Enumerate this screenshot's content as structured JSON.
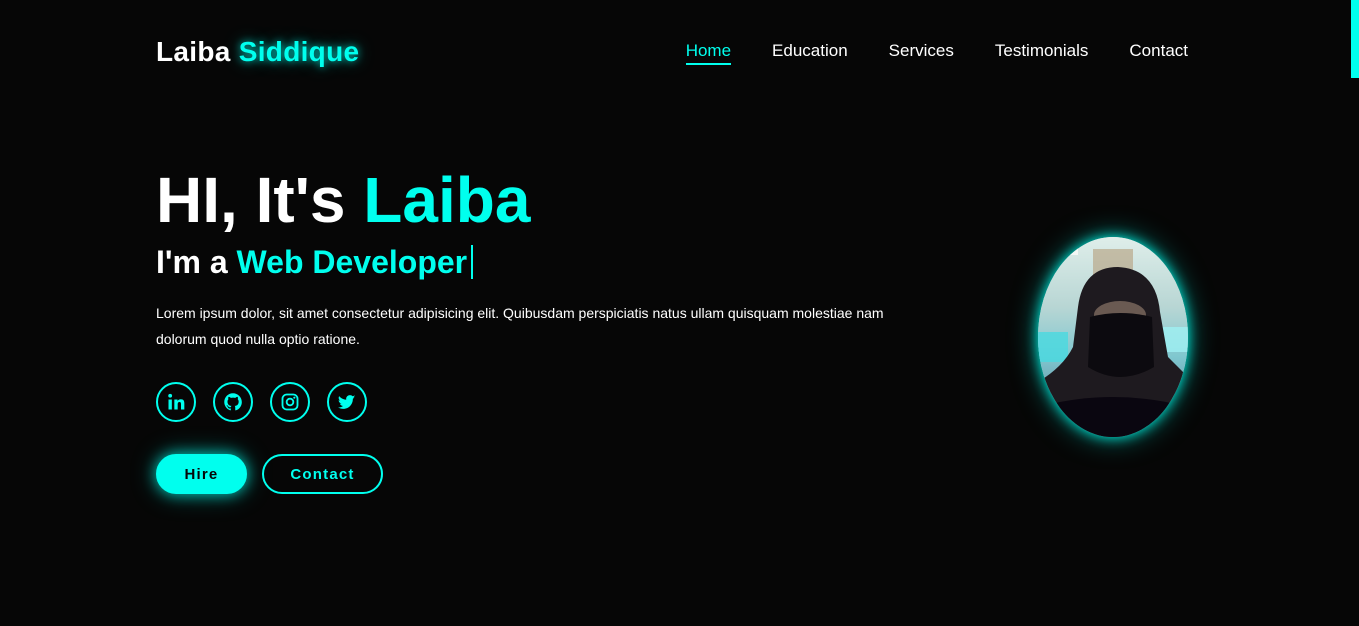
{
  "brand": {
    "first": "Laiba",
    "last": "Siddique"
  },
  "nav": [
    {
      "label": "Home",
      "active": true
    },
    {
      "label": "Education"
    },
    {
      "label": "Services"
    },
    {
      "label": "Testimonials"
    },
    {
      "label": "Contact"
    }
  ],
  "hero": {
    "greeting": "HI, It's",
    "name": "Laiba",
    "role_prefix": "I'm a",
    "role": "Web Developer",
    "text": "Lorem ipsum dolor, sit amet consectetur adipisicing elit. Quibusdam perspiciatis natus ullam quisquam molestiae nam dolorum quod nulla optio ratione."
  },
  "socials": [
    {
      "icon": "linkedin-icon"
    },
    {
      "icon": "github-icon"
    },
    {
      "icon": "instagram-icon"
    },
    {
      "icon": "twitter-icon"
    }
  ],
  "buttons": {
    "hire": "Hire",
    "contact": "Contact"
  },
  "colors": {
    "accent": "#00ffee",
    "background": "#060606",
    "text": "#ffffff"
  }
}
